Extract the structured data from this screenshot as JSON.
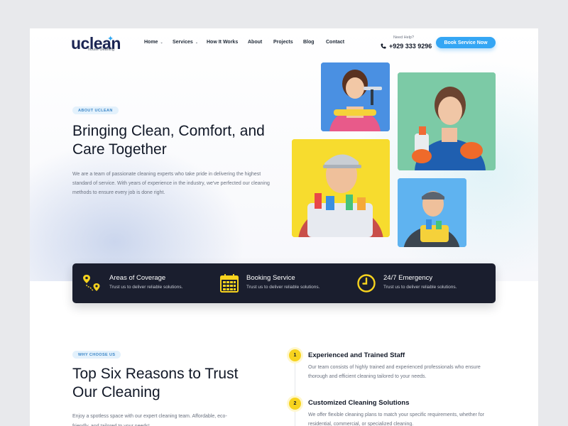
{
  "brand": {
    "name": "uclean",
    "tagline": "house cleaning",
    "accent": "#34a6f4",
    "dark": "#1a1e2e",
    "yellow": "#f7d31e"
  },
  "nav": {
    "items": [
      {
        "label": "Home",
        "dropdown": true
      },
      {
        "label": "Services",
        "dropdown": true
      },
      {
        "label": "How It Works",
        "dropdown": false
      },
      {
        "label": "About",
        "dropdown": false
      },
      {
        "label": "Projects",
        "dropdown": false
      },
      {
        "label": "Blog",
        "dropdown": false
      },
      {
        "label": "Contact",
        "dropdown": false
      }
    ],
    "help_label": "Need Help?",
    "phone": "+929 333 9296",
    "phone_icon": "phone-icon",
    "cta": "Book Service Now",
    "caret_icon": "chevron-down-icon"
  },
  "hero": {
    "badge": "ABOUT UCLEAN",
    "title": "Bringing Clean, Comfort, and Care Together",
    "description": "We are a team of passionate cleaning experts who take pride in delivering the highest standard of service. With years of experience in the industry, we've perfected our cleaning methods to ensure every job is done right.",
    "photo_backgrounds": [
      "#4a90e2",
      "#7ccaa6",
      "#f7dc2e",
      "#5fb3f0"
    ]
  },
  "features": [
    {
      "icon": "map-pin-route-icon",
      "title": "Areas of Coverage",
      "desc": "Trust us to deliver reliable solutions."
    },
    {
      "icon": "calendar-icon",
      "title": "Booking Service",
      "desc": "Trust us to deliver reliable solutions."
    },
    {
      "icon": "clock-icon",
      "title": "24/7 Emergency",
      "desc": "Trust us to deliver reliable solutions."
    }
  ],
  "why": {
    "badge": "WHY CHOOSE US",
    "title": "Top Six Reasons to Trust Our Cleaning",
    "description": "Enjoy a spotless space with our expert cleaning team. Affordable, eco-friendly, and tailored to your needs!",
    "reasons": [
      {
        "num": "1",
        "title": "Experienced and Trained Staff",
        "desc": "Our team consists of highly trained and experienced professionals who ensure thorough and efficient cleaning tailored to your needs."
      },
      {
        "num": "2",
        "title": "Customized Cleaning Solutions",
        "desc": "We offer flexible cleaning plans to match your specific requirements, whether for residential, commercial, or specialized cleaning."
      }
    ]
  }
}
